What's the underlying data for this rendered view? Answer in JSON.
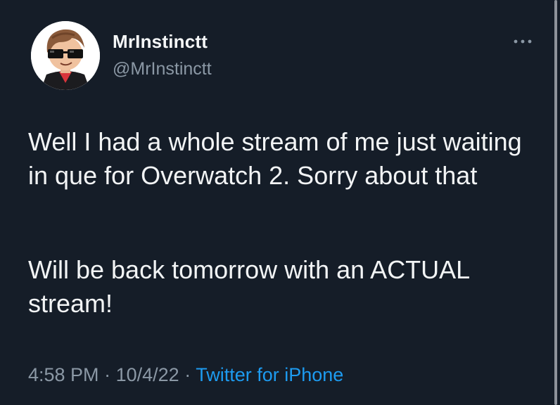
{
  "tweet": {
    "display_name": "MrInstinctt",
    "handle": "@MrInstinctt",
    "paragraph_1": "Well I had a whole stream of me just waiting in que for Overwatch 2. Sorry about that",
    "paragraph_2": "Will be back tomorrow with an ACTUAL stream!",
    "time": "4:58 PM",
    "separator": "·",
    "date": "10/4/22",
    "source": "Twitter for iPhone"
  },
  "icons": {
    "more": "more-options-icon",
    "avatar": "cartoon-avatar-with-sunglasses"
  },
  "colors": {
    "background": "#151d28",
    "text": "#e7e9ea",
    "muted": "#8b98a5",
    "link": "#1d9bf0"
  }
}
